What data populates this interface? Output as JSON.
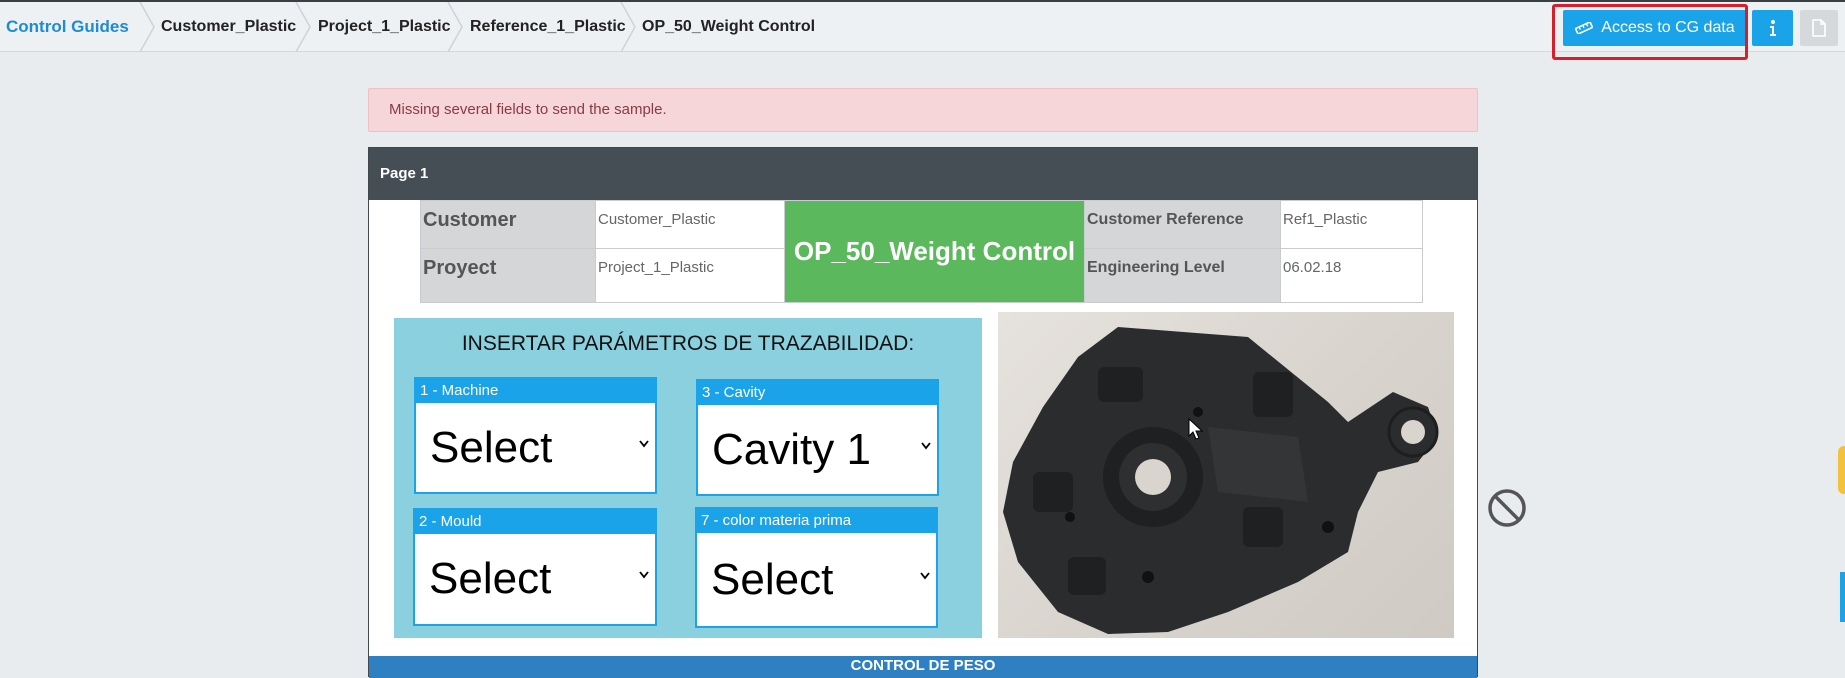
{
  "breadcrumb": [
    {
      "label": "Control Guides"
    },
    {
      "label": "Customer_Plastic"
    },
    {
      "label": "Project_1_Plastic"
    },
    {
      "label": "Reference_1_Plastic"
    },
    {
      "label": "OP_50_Weight Control"
    }
  ],
  "toolbar": {
    "access_label": "Access to CG data",
    "access_icon": "ruler-icon",
    "info_icon": "info-icon",
    "doc_icon": "document-icon"
  },
  "alert": {
    "message": "Missing several fields to send the sample."
  },
  "panel": {
    "title": "Page 1",
    "info": {
      "customer_label": "Customer",
      "customer_value": "Customer_Plastic",
      "project_label": "Proyect",
      "project_value": "Project_1_Plastic",
      "operation": "OP_50_Weight Control",
      "customer_ref_label": "Customer Reference",
      "customer_ref_value": "Ref1_Plastic",
      "eng_level_label": "Engineering Level",
      "eng_level_value": "06.02.18"
    },
    "traceability": {
      "title": "INSERTAR PARÁMETROS DE TRAZABILIDAD:",
      "fields": [
        {
          "label": "1 - Machine",
          "value": "Select"
        },
        {
          "label": "3 - Cavity",
          "value": "Cavity 1"
        },
        {
          "label": "2 - Mould",
          "value": "Select"
        },
        {
          "label": "7 - color materia prima",
          "value": "Select"
        }
      ]
    },
    "section_title": "CONTROL DE PESO"
  },
  "colors": {
    "accent": "#1ba3ea",
    "operation_bg": "#5cb85c",
    "alert_bg": "#f6d6d9",
    "panel_header": "#454d55",
    "highlight": "#d81e2a",
    "trace_bg": "#8ad0de"
  }
}
